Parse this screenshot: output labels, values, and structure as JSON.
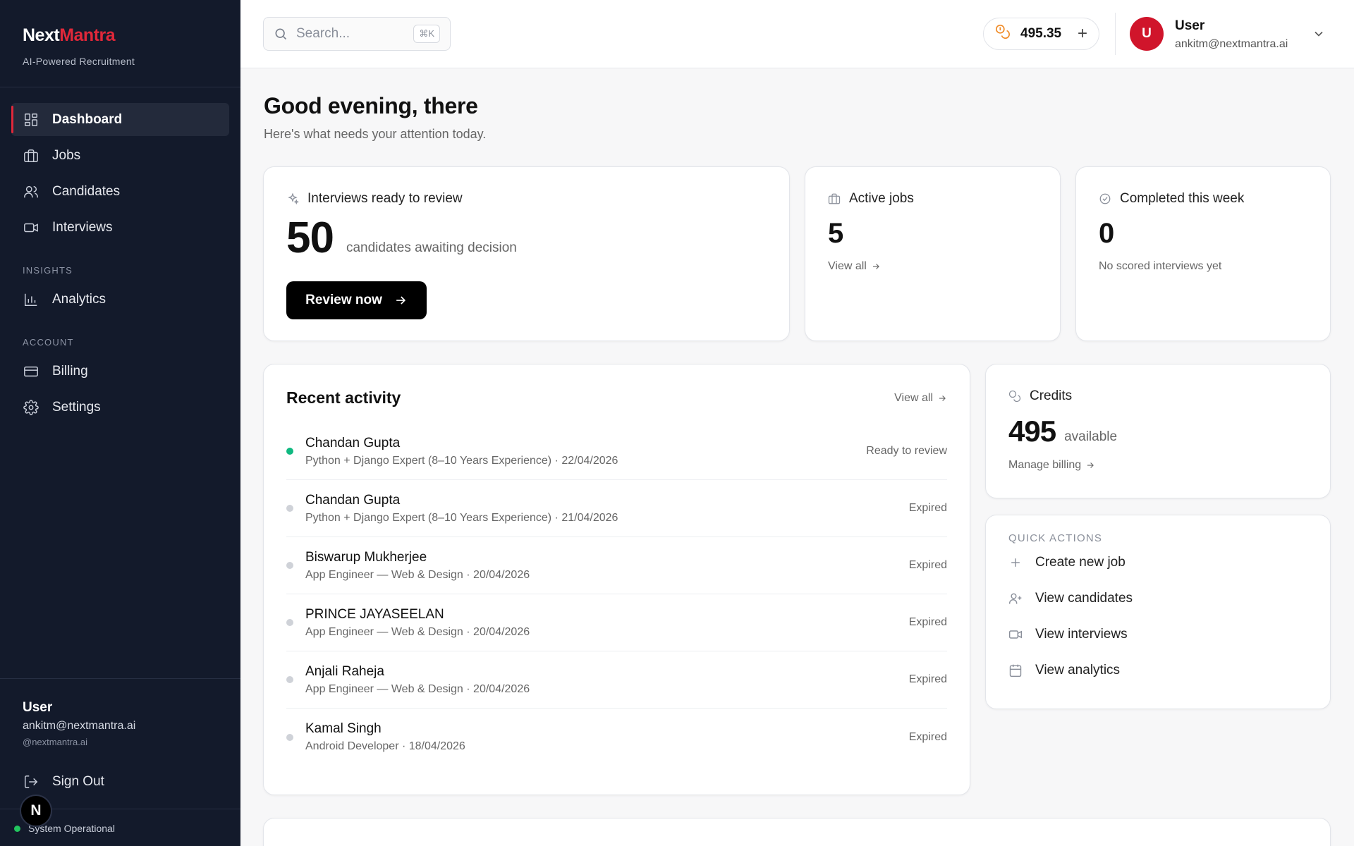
{
  "brand": {
    "name_part1": "Next",
    "name_part2": "Mantra",
    "tagline": "AI-Powered Recruitment"
  },
  "nav": {
    "main": [
      {
        "label": "Dashboard",
        "icon": "dashboard-icon",
        "active": true
      },
      {
        "label": "Jobs",
        "icon": "briefcase-icon"
      },
      {
        "label": "Candidates",
        "icon": "users-icon"
      },
      {
        "label": "Interviews",
        "icon": "video-icon"
      }
    ],
    "insights_label": "INSIGHTS",
    "insights": [
      {
        "label": "Analytics",
        "icon": "bar-chart-icon"
      }
    ],
    "account_label": "ACCOUNT",
    "account": [
      {
        "label": "Billing",
        "icon": "credit-card-icon"
      },
      {
        "label": "Settings",
        "icon": "gear-icon"
      }
    ]
  },
  "sidebar_user": {
    "name": "User",
    "email": "ankitm@nextmantra.ai",
    "handle": "@nextmantra.ai",
    "sign_out": "Sign Out"
  },
  "status": {
    "text": "System Operational",
    "badge": "N"
  },
  "topbar": {
    "search_placeholder": "Search...",
    "search_shortcut": "⌘K",
    "credits": "495.35",
    "avatar_letter": "U",
    "user_name": "User",
    "user_email": "ankitm@nextmantra.ai"
  },
  "greeting": {
    "title": "Good evening, there",
    "subtitle": "Here's what needs your attention today."
  },
  "interviews_card": {
    "title": "Interviews ready to review",
    "count": "50",
    "desc": "candidates awaiting decision",
    "button": "Review now"
  },
  "active_jobs": {
    "title": "Active jobs",
    "count": "5",
    "link": "View all"
  },
  "completed": {
    "title": "Completed this week",
    "count": "0",
    "note": "No scored interviews yet"
  },
  "recent_activity": {
    "title": "Recent activity",
    "view_all": "View all",
    "items": [
      {
        "name": "Chandan Gupta",
        "meta": "Python + Django Expert (8–10 Years Experience) · 22/04/2026",
        "status": "Ready to review",
        "status_color": "#10b981"
      },
      {
        "name": "Chandan Gupta",
        "meta": "Python + Django Expert (8–10 Years Experience) · 21/04/2026",
        "status": "Expired"
      },
      {
        "name": "Biswarup Mukherjee",
        "meta": "App Engineer — Web & Design · 20/04/2026",
        "status": "Expired"
      },
      {
        "name": "PRINCE JAYASEELAN",
        "meta": "App Engineer — Web & Design · 20/04/2026",
        "status": "Expired"
      },
      {
        "name": "Anjali Raheja",
        "meta": "App Engineer — Web & Design · 20/04/2026",
        "status": "Expired"
      },
      {
        "name": "Kamal Singh",
        "meta": "Android Developer · 18/04/2026",
        "status": "Expired"
      }
    ]
  },
  "credits_card": {
    "title": "Credits",
    "count": "495",
    "desc": "available",
    "link": "Manage billing"
  },
  "quick_actions": {
    "title": "QUICK ACTIONS",
    "items": [
      {
        "label": "Create new job",
        "icon": "plus-icon"
      },
      {
        "label": "View candidates",
        "icon": "user-plus-icon"
      },
      {
        "label": "View interviews",
        "icon": "video-icon"
      },
      {
        "label": "View analytics",
        "icon": "calendar-icon"
      }
    ]
  },
  "colors": {
    "accent": "#e0283a",
    "sidebar_bg": "#131a2b",
    "success": "#10b981",
    "coin": "#f08a24"
  }
}
